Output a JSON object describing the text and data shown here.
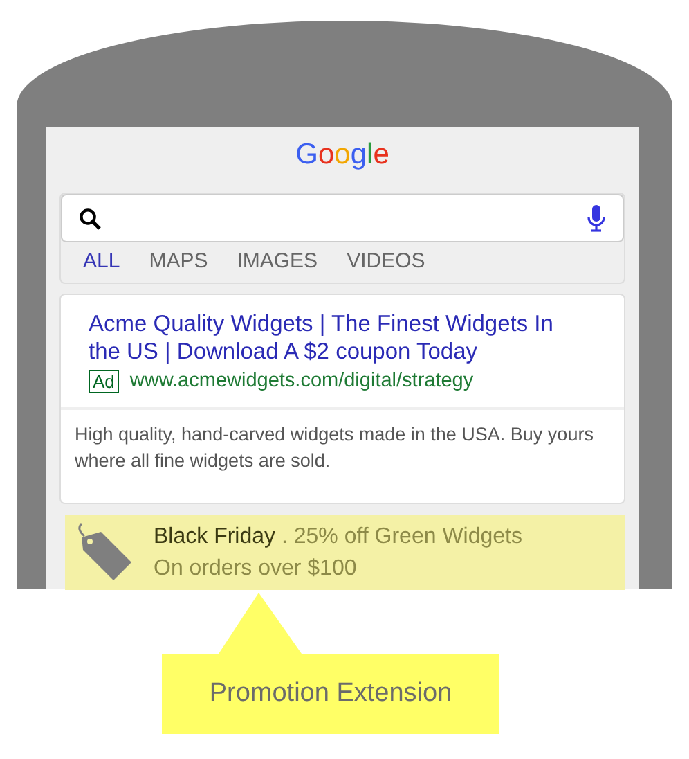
{
  "logo": "Google",
  "tabs": [
    {
      "label": "ALL",
      "selected": true
    },
    {
      "label": "MAPS",
      "selected": false
    },
    {
      "label": "IMAGES",
      "selected": false
    },
    {
      "label": "VIDEOS",
      "selected": false
    }
  ],
  "ad": {
    "title": "Acme Quality Widgets | The Finest Widgets In the US | Download A $2 coupon Today",
    "badge": "Ad",
    "url": "www.acmewidgets.com/digital/strategy",
    "description": "High quality, hand-carved widgets made in the USA. Buy yours where all fine widgets are sold."
  },
  "promotion": {
    "occasion": "Black Friday",
    "offer": ". 25% off Green Widgets",
    "condition": "On orders over $100"
  },
  "callout": "Promotion Extension"
}
